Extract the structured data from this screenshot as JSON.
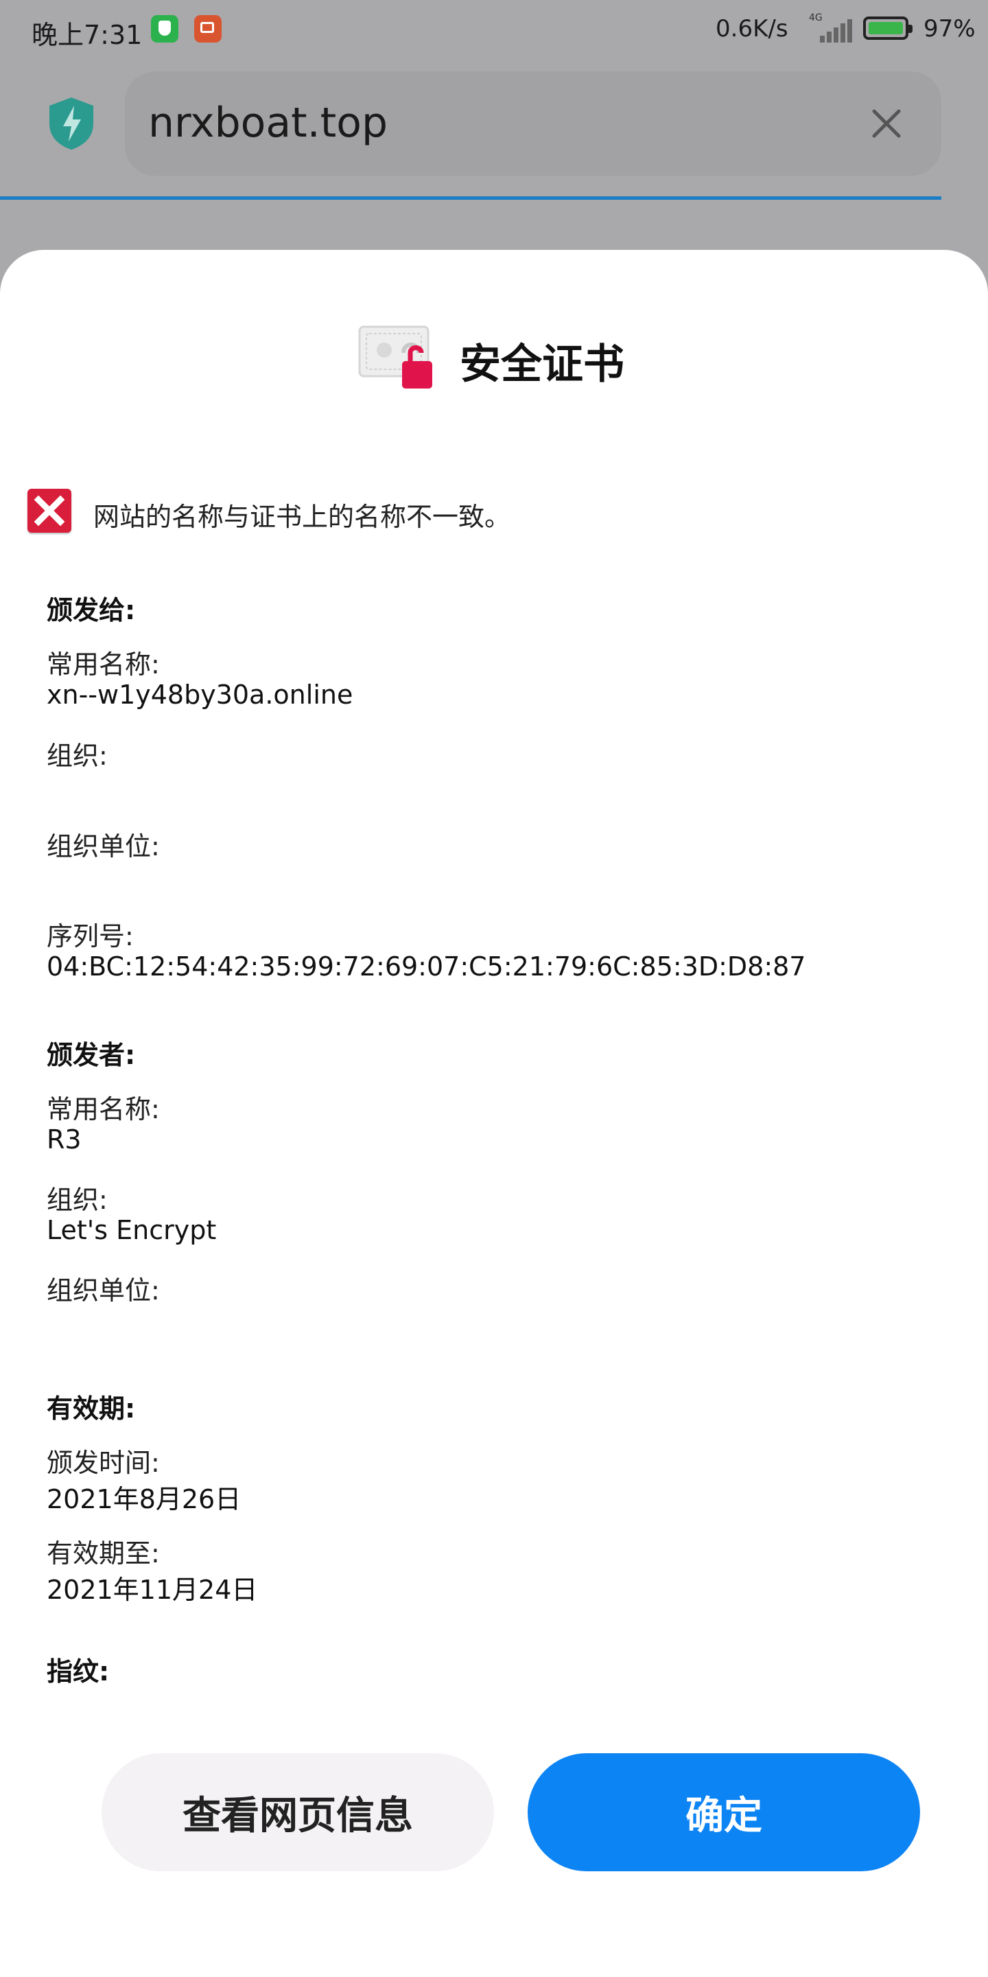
{
  "status_bar": {
    "time": "晚上7:31",
    "speed": "0.6K/s",
    "network": "4G",
    "battery": "97%"
  },
  "address_bar": {
    "url": "nrxboat.top"
  },
  "dialog": {
    "title": "安全证书",
    "warning": "网站的名称与证书上的名称不一致。",
    "issued_to": {
      "heading": "颁发给:",
      "common_name_label": "常用名称:",
      "common_name_value": "xn--w1y48by30a.online",
      "org_label": "组织:",
      "org_value": "",
      "org_unit_label": "组织单位:",
      "org_unit_value": "",
      "serial_label": "序列号:",
      "serial_value": "04:BC:12:54:42:35:99:72:69:07:C5:21:79:6C:85:3D:D8:87"
    },
    "issued_by": {
      "heading": "颁发者:",
      "common_name_label": "常用名称:",
      "common_name_value": "R3",
      "org_label": "组织:",
      "org_value": "Let's Encrypt",
      "org_unit_label": "组织单位:",
      "org_unit_value": ""
    },
    "validity": {
      "heading": "有效期:",
      "issued_on_label": "颁发时间:",
      "issued_on_value": "2021年8月26日",
      "expires_on_label": "有效期至:",
      "expires_on_value": "2021年11月24日"
    },
    "fingerprint": {
      "heading": "指纹:"
    },
    "buttons": {
      "view_page_info": "查看网页信息",
      "ok": "确定"
    }
  },
  "colors": {
    "primary_button": "#0d84f4",
    "warning_red": "#d81e3a",
    "shield_teal": "#2b9a8f"
  }
}
